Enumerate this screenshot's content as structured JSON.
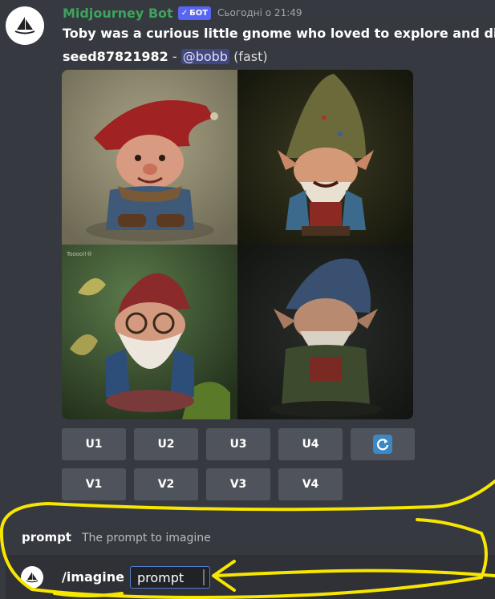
{
  "message": {
    "author": "Midjourney Bot",
    "bot_tag": "БОТ",
    "timestamp": "Сьогодні о 21:49",
    "title": "Toby was a curious little gnome who loved to explore and disc",
    "seed": "seed87821982",
    "separator": " - ",
    "mention": "@bobb",
    "speed": "(fast)",
    "avatar_icon": "sailboat-logo-icon"
  },
  "image_grid": {
    "watermark": "Tooooi!®",
    "tiles": [
      "gnome-red-hat",
      "gnome-green-hat",
      "gnome-glasses",
      "gnome-blue-hat"
    ]
  },
  "buttons": {
    "upscale": [
      "U1",
      "U2",
      "U3",
      "U4"
    ],
    "variation": [
      "V1",
      "V2",
      "V3",
      "V4"
    ],
    "reroll_icon": "refresh-icon"
  },
  "command_panel": {
    "option_name": "prompt",
    "option_description": "The prompt to imagine",
    "command": "/imagine",
    "param_label": "prompt"
  },
  "colors": {
    "background": "#36393f",
    "username": "#3ba55c",
    "bot_tag": "#5865f2",
    "button": "#4f545c",
    "annotation": "#f7e600"
  }
}
